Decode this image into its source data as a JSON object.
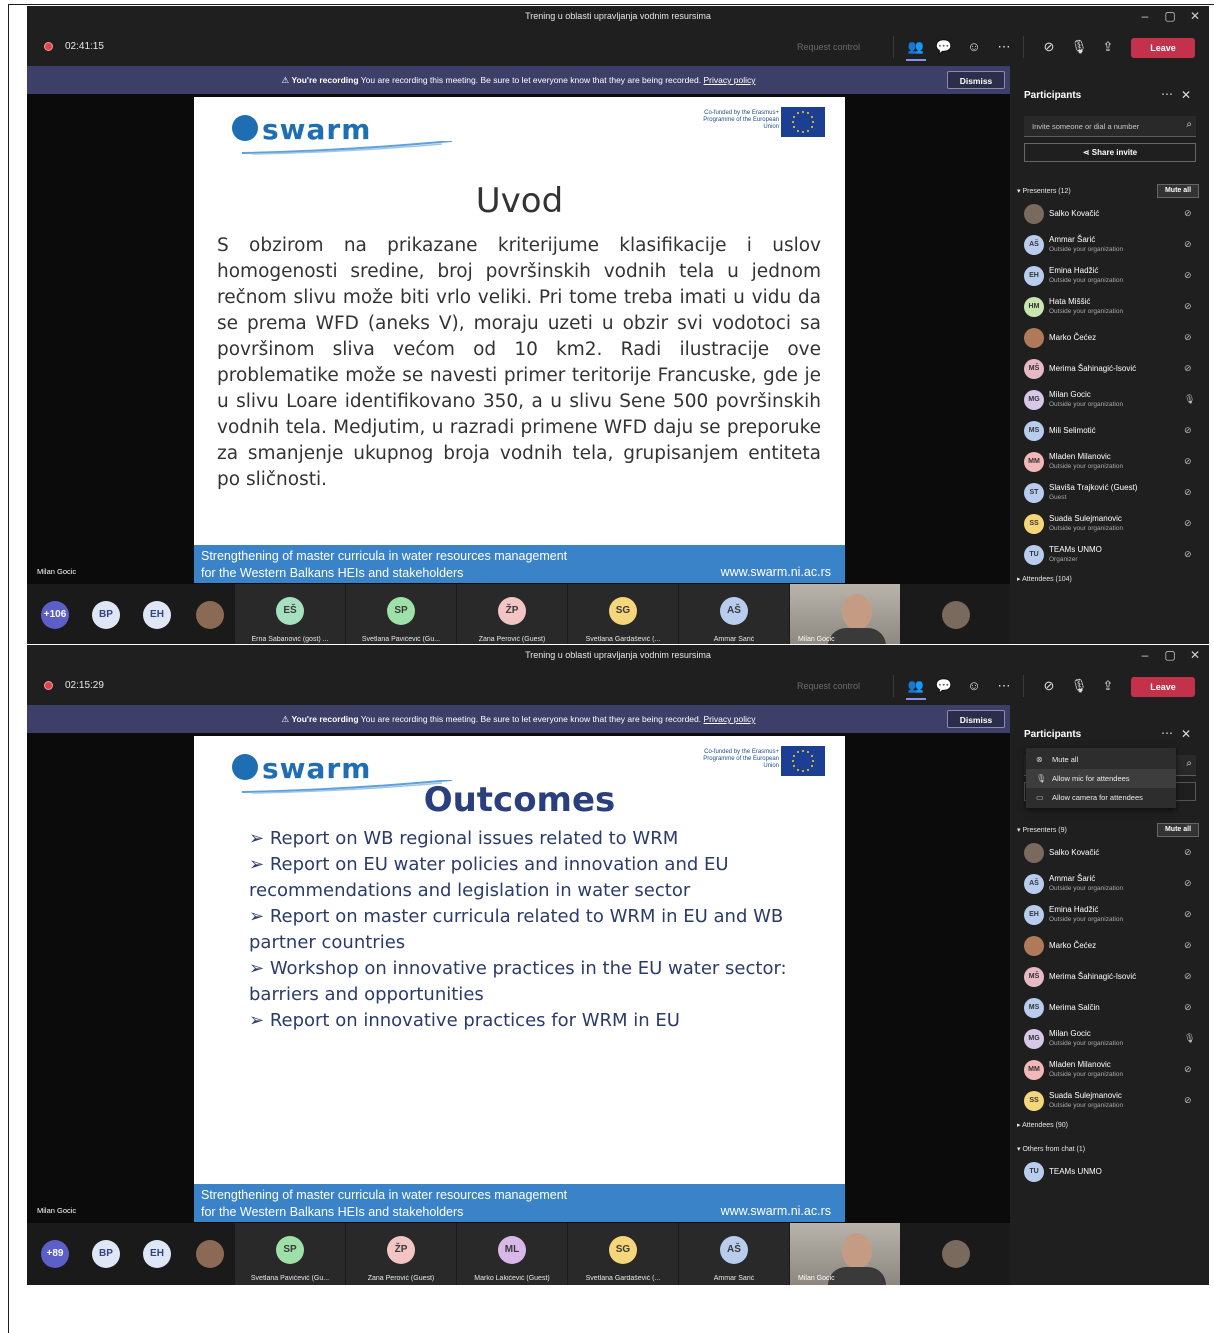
{
  "windows": [
    {
      "title": "Trening u oblasti upravljanja vodnim resursima",
      "window_controls": {
        "minimize": "–",
        "maximize": "▢",
        "close": "✕"
      },
      "toolbar": {
        "timer": "02:41:15",
        "request_control": "Request control",
        "leave": "Leave"
      },
      "banner": {
        "bold": "You're recording",
        "text": "You are recording this meeting. Be sure to let everyone know that they are being recorded.",
        "link": "Privacy policy",
        "dismiss": "Dismiss"
      },
      "slide": {
        "logo": "swarm",
        "cofunded": "Co-funded by the Erasmus+ Programme of the European Union",
        "title": "Uvod",
        "body": "S obzirom na prikazane kriterijume klasifikacije i uslov homogenosti sredine, broj površinskih vodnih tela u jednom rečnom slivu može biti vrlo veliki. Pri tome treba imati u vidu da se prema WFD (aneks V), moraju uzeti u obzir svi vodotoci sa površinom sliva većom od 10 km2. Radi ilustracije ove problematike može se navesti primer teritorije Francuske, gde je u slivu Loare identifikovano 350, a u slivu Sene 500 površinskih vodnih tela. Medjutim, u razradi primene WFD daju se preporuke za smanjenje ukupnog broja vodnih tela, grupisanjem entiteta po sličnosti.",
        "footer_line1": "Strengthening of master curricula in water resources  management",
        "footer_line2": "for the Western Balkans HEIs and stakeholders",
        "footer_url": "www.swarm.ni.ac.rs"
      },
      "speaker": "Milan Gocic",
      "strip": {
        "more": "+106",
        "avatars": [
          {
            "initials": "BP"
          },
          {
            "initials": "EH"
          }
        ],
        "tiles": [
          {
            "initials": "EŠ",
            "name": "Erna Šabanović (gost) ...",
            "color": "#a6e0c0"
          },
          {
            "initials": "SP",
            "name": "Svetlana Pavićević (Gu...",
            "color": "#9fe0a8"
          },
          {
            "initials": "ŽP",
            "name": "Žana Perović (Guest)",
            "color": "#f3c4c4"
          },
          {
            "initials": "SG",
            "name": "Svetlana Gardašević (...",
            "color": "#f5d67a"
          },
          {
            "initials": "AŠ",
            "name": "Ammar Šarić",
            "color": "#b8cdee"
          }
        ],
        "video_name": "Milan Gocic"
      },
      "panel": {
        "title": "Participants",
        "invite_placeholder": "Invite someone or dial a number",
        "share_invite": "Share invite",
        "presenters_label": "Presenters (12)",
        "mute_all": "Mute all",
        "participants": [
          {
            "initials": "",
            "name": "Salko Kovačić",
            "sub": "",
            "color": "#7a6a5e"
          },
          {
            "initials": "AŠ",
            "name": "Ammar Šarić",
            "sub": "Outside your organization",
            "color": "#b8cdee"
          },
          {
            "initials": "EH",
            "name": "Emina Hadžić",
            "sub": "Outside your organization",
            "color": "#b8cdee"
          },
          {
            "initials": "HM",
            "name": "Hata Miššić",
            "sub": "Outside your organization",
            "color": "#c8e6b0"
          },
          {
            "initials": "",
            "name": "Marko Čećez",
            "sub": "",
            "color": "#b07a5a"
          },
          {
            "initials": "MŠ",
            "name": "Merima Šahinagić-Isović",
            "sub": "",
            "color": "#e8b8c4"
          },
          {
            "initials": "MG",
            "name": "Milan Gocic",
            "sub": "Outside your organization",
            "color": "#d8c8e8"
          },
          {
            "initials": "MS",
            "name": "Mili Selimotić",
            "sub": "",
            "color": "#b8cdee"
          },
          {
            "initials": "MM",
            "name": "Mladen Milanovic",
            "sub": "Outside your organization",
            "color": "#f0b8b8"
          },
          {
            "initials": "ST",
            "name": "Slaviša Trajković (Guest)",
            "sub": "Guest",
            "color": "#b8cdee"
          },
          {
            "initials": "SS",
            "name": "Suada Sulejmanovic",
            "sub": "Outside your organization",
            "color": "#f5d67a"
          },
          {
            "initials": "TU",
            "name": "TEAMs UNMO",
            "sub": "Organizer",
            "color": "#b8cdee"
          }
        ],
        "attendees_label": "Attendees (104)"
      }
    },
    {
      "title": "Trening u oblasti upravljanja vodnim resursima",
      "window_controls": {
        "minimize": "–",
        "maximize": "▢",
        "close": "✕"
      },
      "toolbar": {
        "timer": "02:15:29",
        "request_control": "Request control",
        "leave": "Leave"
      },
      "banner": {
        "bold": "You're recording",
        "text": "You are recording this meeting. Be sure to let everyone know that they are being recorded.",
        "link": "Privacy policy",
        "dismiss": "Dismiss"
      },
      "slide": {
        "logo": "swarm",
        "cofunded": "Co-funded by the Erasmus+ Programme of the European Union",
        "title": "Outcomes",
        "bullets": [
          "Report on WB regional issues related to WRM",
          "Report on EU water policies and innovation and EU recommendations and legislation in water sector",
          "Report on master curricula related to WRM in EU and WB partner countries",
          "Workshop on innovative practices in the EU water sector: barriers and opportunities",
          "Report on innovative practices for WRM in EU"
        ],
        "footer_line1": "Strengthening of master curricula in water resources  management",
        "footer_line2": "for the Western Balkans HEIs and stakeholders",
        "footer_url": "www.swarm.ni.ac.rs"
      },
      "speaker": "Milan Gocic",
      "strip": {
        "more": "+89",
        "avatars": [
          {
            "initials": "BP"
          },
          {
            "initials": "EH"
          }
        ],
        "tiles": [
          {
            "initials": "SP",
            "name": "Svetlana Pavićević (Gu...",
            "color": "#9fe0a8"
          },
          {
            "initials": "ŽP",
            "name": "Žana Perović (Guest)",
            "color": "#f3c4c4"
          },
          {
            "initials": "ML",
            "name": "Marko Lakićević (Guest)",
            "color": "#d8b8e8"
          },
          {
            "initials": "SG",
            "name": "Svetlana Gardašević (...",
            "color": "#f5d67a"
          },
          {
            "initials": "AŠ",
            "name": "Ammar Šarić",
            "color": "#b8cdee"
          }
        ],
        "video_name": "Milan Gocic"
      },
      "panel": {
        "title": "Participants",
        "menu": [
          "Mute all",
          "Allow mic for attendees",
          "Allow camera for attendees"
        ],
        "presenters_label": "Presenters (9)",
        "mute_all": "Mute all",
        "participants": [
          {
            "initials": "",
            "name": "Salko Kovačić",
            "sub": "",
            "color": "#7a6a5e"
          },
          {
            "initials": "AŠ",
            "name": "Ammar Šarić",
            "sub": "Outside your organization",
            "color": "#b8cdee"
          },
          {
            "initials": "EH",
            "name": "Emina Hadžić",
            "sub": "Outside your organization",
            "color": "#b8cdee"
          },
          {
            "initials": "",
            "name": "Marko Čećez",
            "sub": "",
            "color": "#b07a5a"
          },
          {
            "initials": "MŠ",
            "name": "Merima Šahinagić-Isović",
            "sub": "",
            "color": "#e8b8c4"
          },
          {
            "initials": "MS",
            "name": "Merima Salčin",
            "sub": "",
            "color": "#b8cdee"
          },
          {
            "initials": "MG",
            "name": "Milan Gocic",
            "sub": "Outside your organization",
            "color": "#d8c8e8"
          },
          {
            "initials": "MM",
            "name": "Mladen Milanovic",
            "sub": "Outside your organization",
            "color": "#f0b8b8"
          },
          {
            "initials": "SS",
            "name": "Suada Sulejmanovic",
            "sub": "Outside your organization",
            "color": "#f5d67a"
          }
        ],
        "attendees_label": "Attendees (90)",
        "others_label": "Others from chat (1)",
        "others": [
          {
            "initials": "TU",
            "name": "TEAMs UNMO",
            "color": "#b8cdee"
          }
        ]
      }
    }
  ],
  "colors": {
    "leave": "#c4314b",
    "banner": "#3d3f69",
    "footer": "#3a83c8",
    "accent": "#8b8ff0"
  }
}
